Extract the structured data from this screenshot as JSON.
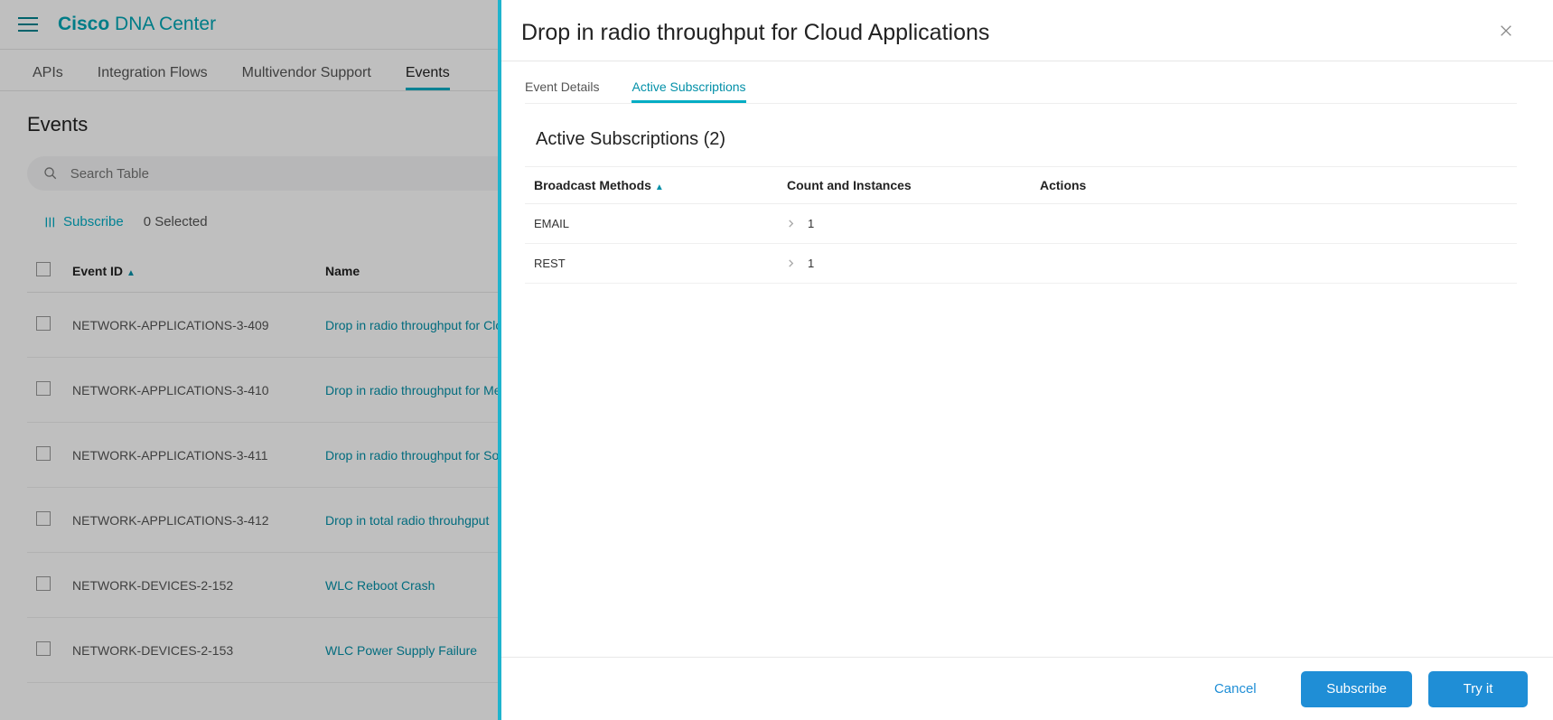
{
  "brand": {
    "strong": "Cisco",
    "rest": " DNA Center"
  },
  "mainTabs": [
    "APIs",
    "Integration Flows",
    "Multivendor Support",
    "Events"
  ],
  "mainActiveTab": 3,
  "pageTitle": "Events",
  "search": {
    "placeholder": "Search Table",
    "value": ""
  },
  "tableActions": {
    "subscribe": "Subscribe",
    "selected": "0 Selected"
  },
  "eventColumns": {
    "id": "Event ID",
    "name": "Name"
  },
  "events": [
    {
      "id": "NETWORK-APPLICATIONS-3-409",
      "name": "Drop in radio throughput for Cloud Applications"
    },
    {
      "id": "NETWORK-APPLICATIONS-3-410",
      "name": "Drop in radio throughput for Media Applications"
    },
    {
      "id": "NETWORK-APPLICATIONS-3-411",
      "name": "Drop in radio throughput for Social Applications"
    },
    {
      "id": "NETWORK-APPLICATIONS-3-412",
      "name": "Drop in total radio throuhgput"
    },
    {
      "id": "NETWORK-DEVICES-2-152",
      "name": "WLC Reboot Crash"
    },
    {
      "id": "NETWORK-DEVICES-2-153",
      "name": "WLC Power Supply Failure"
    }
  ],
  "panel": {
    "title": "Drop in radio throughput for Cloud Applications",
    "subtabs": [
      "Event Details",
      "Active Subscriptions"
    ],
    "activeSubtab": 1,
    "heading": "Active Subscriptions (2)",
    "columns": {
      "method": "Broadcast Methods",
      "count": "Count and Instances",
      "actions": "Actions"
    },
    "rows": [
      {
        "method": "EMAIL",
        "count": "1"
      },
      {
        "method": "REST",
        "count": "1"
      }
    ],
    "footer": {
      "cancel": "Cancel",
      "subscribe": "Subscribe",
      "try": "Try it"
    }
  }
}
